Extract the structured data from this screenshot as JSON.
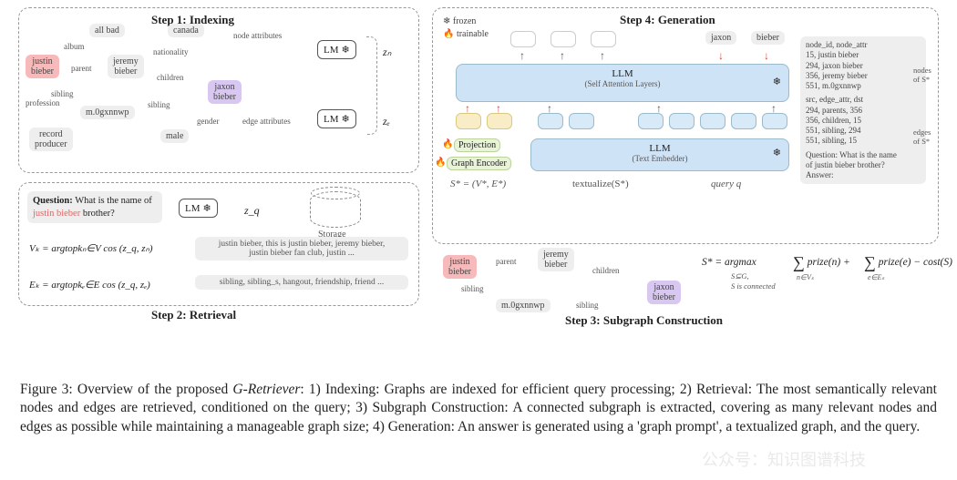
{
  "steps": {
    "s1": "Step 1: Indexing",
    "s2": "Step 2: Retrieval",
    "s3": "Step 3: Subgraph Construction",
    "s4": "Step 4: Generation"
  },
  "legend": {
    "frozen": "frozen",
    "trainable": "trainable"
  },
  "nodes": {
    "justin": "justin\nbieber",
    "allbad": "all bad",
    "canada": "canada",
    "jeremy": "jeremy\nbieber",
    "jaxon": "jaxon\nbieber",
    "mcode": "m.0gxnnwp",
    "male": "male",
    "record": "record\nproducer"
  },
  "edges_s1": {
    "album": "album",
    "nationality": "nationality",
    "parent": "parent",
    "children": "children",
    "sibling": "sibling",
    "gender": "gender",
    "profession": "profession",
    "node_attrs": "node attributes",
    "edge_attrs": "edge attributes"
  },
  "lm": "LM",
  "zvars": {
    "zn": "zₙ",
    "ze": "zₑ",
    "zq": "z_q"
  },
  "storage": "Storage",
  "question_prefix": "Question:",
  "question": " What is the name\nof justin bieber brother?",
  "question_hl": "justin bieber",
  "equations": {
    "vk": "Vₖ = argtopkₙ∈V cos (z_q, zₙ)",
    "ek": "Eₖ = argtopkₑ∈E cos (z_q, zₑ)"
  },
  "retrieval_lists": {
    "nodes": "justin bieber, this is justin bieber, jeremy bieber,\njustin bieber fan club, justin ...",
    "edges": "sibling, sibling_s, hangout, friendship, friend ..."
  },
  "step4": {
    "llm_top": "LLM",
    "llm_top_sub": "(Self Attention Layers)",
    "llm_bot": "LLM",
    "llm_bot_sub": "(Text Embedder)",
    "projection": "Projection",
    "graph_encoder": "Graph Encoder",
    "sstar_eq": "S* = (V*, E*)",
    "textualize": "textualize(S*)",
    "queryq": "query q",
    "outputs": [
      "",
      "",
      "",
      "jaxon",
      "bieber"
    ],
    "sidecard_nodes": "node_id, node_attr\n15, justin bieber\n294, jaxon bieber\n356, jeremy bieber\n551, m.0gxnnwp",
    "sidecard_edges": "src, edge_attr, dst\n294, parents, 356\n356, children, 15\n551, sibling, 294\n551, sibling, 15",
    "sidecard_q": "Question: What is the name\nof justin bieber brother?\nAnswer:",
    "nodes_of": "nodes of S*",
    "edges_of": "edges of S*"
  },
  "step3": {
    "graph_nodes": {
      "justin": "justin\nbieber",
      "jeremy": "jeremy\nbieber",
      "jaxon": "jaxon\nbieber",
      "mcode": "m.0gxnnwp"
    },
    "graph_edges": {
      "parent": "parent",
      "sibling": "sibling",
      "children": "children"
    },
    "argmax": "S* =   argmax",
    "constraint": "S⊆G,\nS is connected",
    "prize_n": "∑ prize(n) +",
    "prize_e": "∑ prize(e) − cost(S)",
    "sub_n": "n∈Vₛ",
    "sub_e": "e∈Eₛ"
  },
  "caption": {
    "figno": "Figure 3: ",
    "lead": "Overview of the proposed ",
    "model": "G-Retriever",
    "body": ": 1) Indexing: Graphs are indexed for efficient query processing; 2) Retrieval: The most semantically relevant nodes and edges are retrieved, conditioned on the query; 3) Subgraph Construction: A connected subgraph is extracted, covering as many relevant nodes and edges as possible while maintaining a manageable graph size; 4) Generation: An answer is generated using a 'graph prompt', a textualized graph, and the query."
  },
  "watermark": "公众号：知识图谱科技",
  "snowflake": "❄",
  "flame": "🔥"
}
